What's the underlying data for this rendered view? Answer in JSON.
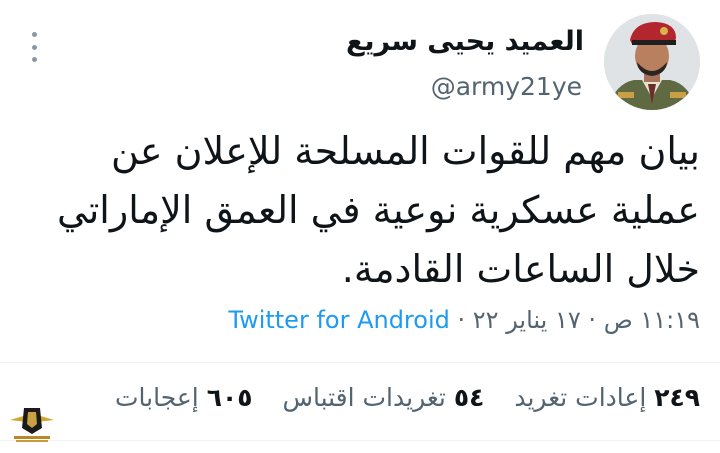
{
  "author": {
    "display_name": "العميد يحيى سريع",
    "handle": "@army21ye",
    "avatar_icon": "person-avatar-icon"
  },
  "tweet": {
    "text": "بيان مهم للقوات المسلحة للإعلان عن عملية عسكرية نوعية في العمق الإماراتي خلال الساعات القادمة.",
    "time": "١١:١٩ ص",
    "date": "١٧ يناير ٢٢",
    "separator": "·",
    "source": "Twitter for Android"
  },
  "stats": {
    "retweets_count": "٢٤٩",
    "retweets_label": "إعادات تغريد",
    "quotes_count": "٥٤",
    "quotes_label": "تغريدات اقتباس",
    "likes_count": "٦٠٥",
    "likes_label": "إعجابات"
  },
  "colors": {
    "text_primary": "#0f1419",
    "text_secondary": "#536471",
    "link": "#1d9bf0",
    "divider": "#eff3f4"
  },
  "icons": {
    "more": "more-vertical-icon",
    "watermark": "forum-logo-watermark"
  }
}
